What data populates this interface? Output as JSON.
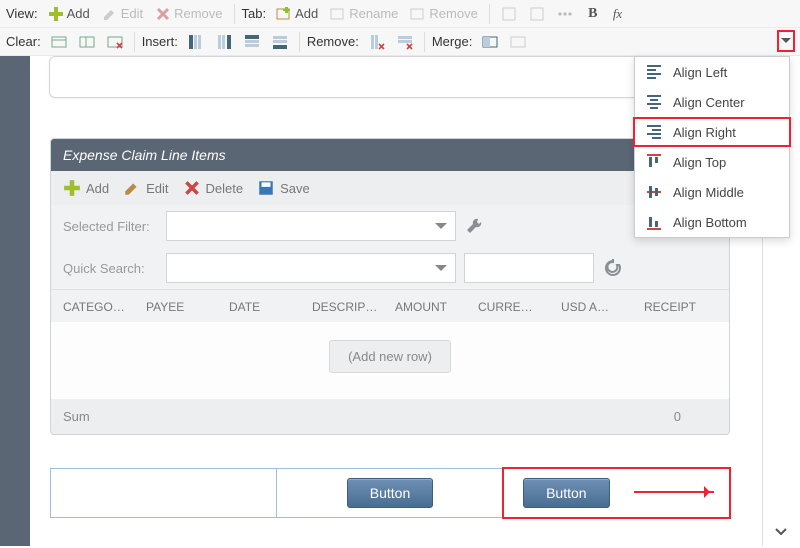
{
  "toolbar": {
    "view_label": "View:",
    "add": "Add",
    "edit": "Edit",
    "remove": "Remove",
    "tab_label": "Tab:",
    "tab_add": "Add",
    "tab_rename": "Rename",
    "tab_remove": "Remove",
    "clear_label": "Clear:",
    "insert_label": "Insert:",
    "remove2_label": "Remove:",
    "merge_label": "Merge:"
  },
  "dropdown": {
    "items": [
      "Align Left",
      "Align Center",
      "Align Right",
      "Align Top",
      "Align Middle",
      "Align Bottom"
    ]
  },
  "panel": {
    "title": "Expense Claim Line Items",
    "add": "Add",
    "edit": "Edit",
    "delete": "Delete",
    "save": "Save",
    "selected_filter": "Selected Filter:",
    "quick_search": "Quick Search:",
    "cols": [
      "CATEGO…",
      "PAYEE",
      "DATE",
      "DESCRIP…",
      "AMOUNT",
      "CURRE…",
      "USD A…",
      "RECEIPT"
    ],
    "add_row": "(Add new row)",
    "sum_label": "Sum",
    "sum_value": "0"
  },
  "buttons": {
    "left": "Button",
    "right": "Button"
  }
}
